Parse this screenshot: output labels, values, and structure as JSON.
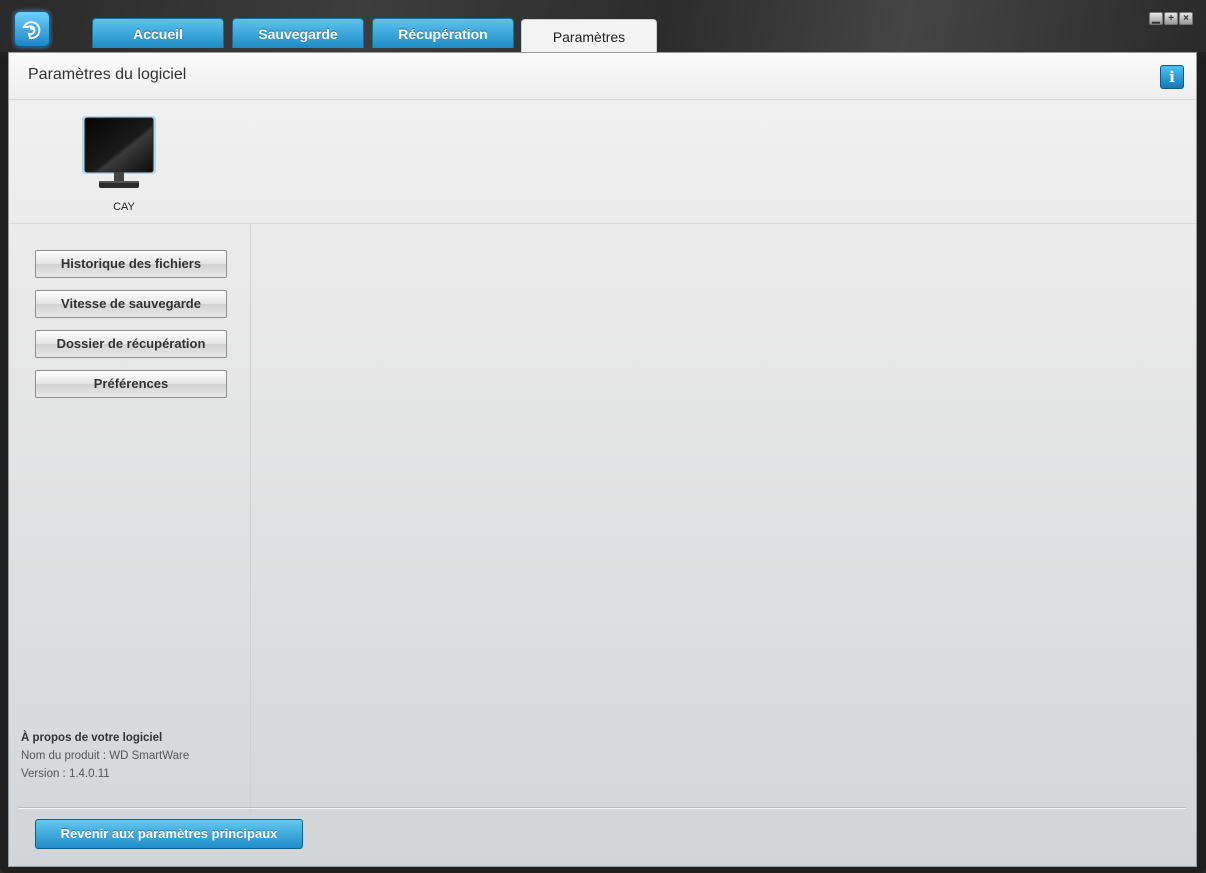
{
  "tabs": [
    {
      "label": "Accueil",
      "active": false
    },
    {
      "label": "Sauvegarde",
      "active": false
    },
    {
      "label": "Récupération",
      "active": false
    },
    {
      "label": "Paramètres",
      "active": true
    }
  ],
  "header": {
    "title": "Paramètres du logiciel",
    "info_icon": "info-icon"
  },
  "device": {
    "name": "CAY",
    "icon": "monitor-icon"
  },
  "sidebar": {
    "buttons": [
      {
        "label": "Historique des fichiers"
      },
      {
        "label": "Vitesse de sauvegarde"
      },
      {
        "label": "Dossier de récupération"
      },
      {
        "label": "Préférences"
      }
    ]
  },
  "about": {
    "title": "À propos de votre logiciel",
    "product": "Nom du produit : WD SmartWare",
    "version": "Version : 1.4.0.11"
  },
  "footer": {
    "back_label": "Revenir aux paramètres principaux"
  },
  "colors": {
    "accent": "#1e8cc4",
    "accent_light": "#5cc3ef"
  }
}
